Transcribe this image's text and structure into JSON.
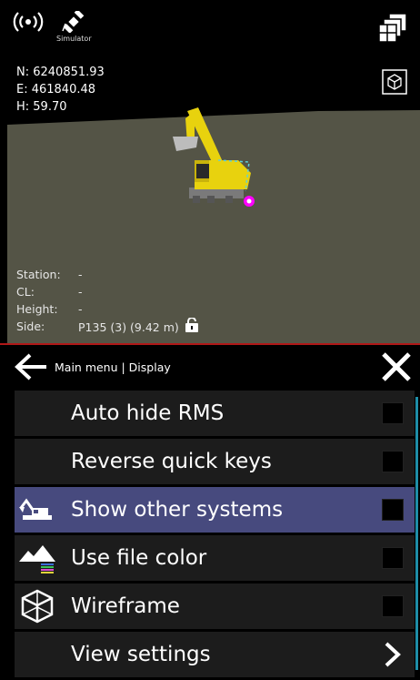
{
  "status": {
    "simulator_label": "Simulator",
    "coords": {
      "n": "N: 6240851.93",
      "e": "E: 461840.48",
      "h": "H: 59.70"
    }
  },
  "info": {
    "station_label": "Station:",
    "station_value": "-",
    "cl_label": "CL:",
    "cl_value": "-",
    "height_label": "Height:",
    "height_value": "-",
    "side_label": "Side:",
    "side_value": "P135 (3) (9.42 m)"
  },
  "menu": {
    "breadcrumb": "Main menu | Display",
    "items": [
      {
        "label": "Auto hide RMS",
        "icon": "none",
        "control": "checkbox",
        "checked": false
      },
      {
        "label": "Reverse quick keys",
        "icon": "none",
        "control": "checkbox",
        "checked": false
      },
      {
        "label": "Show other systems",
        "icon": "excavator-icon",
        "control": "checkbox",
        "checked": false,
        "selected": true
      },
      {
        "label": "Use file color",
        "icon": "mountain-color-icon",
        "control": "checkbox",
        "checked": false
      },
      {
        "label": "Wireframe",
        "icon": "wireframe-cube-icon",
        "control": "checkbox",
        "checked": false
      },
      {
        "label": "View settings",
        "icon": "none",
        "control": "chevron"
      }
    ]
  },
  "colors": {
    "ground": "#545446",
    "selected_row": "#474a7e",
    "row": "#1c1c1c",
    "accent": "#1e8ea8",
    "divider": "#b01818"
  }
}
